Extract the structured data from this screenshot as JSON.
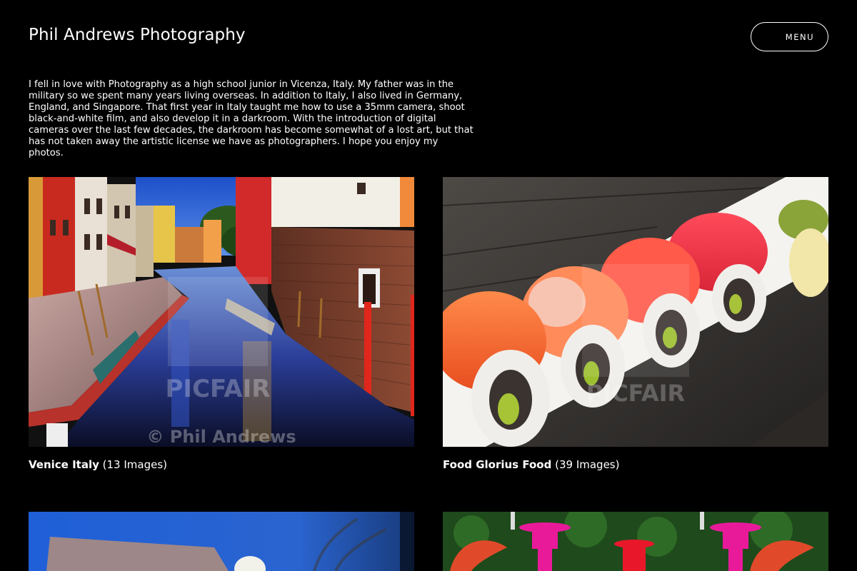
{
  "header": {
    "site_title": "Phil Andrews Photography",
    "menu_label": "MENU"
  },
  "intro": {
    "text": "I fell in love with Photography as a high school junior in Vicenza, Italy. My father was in the military so we spent many years living overseas. In addition to Italy, I also lived in Germany, England, and Singapore. That first year in Italy taught me how to use a 35mm camera, shoot black-and-white film, and also develop it in a darkroom. With the introduction of digital cameras over the last few decades, the darkroom has become somewhat of a lost art, but that has not taken away the artistic license we have as photographers. I hope you enjoy my photos."
  },
  "galleries": [
    {
      "title": "Venice Italy",
      "count": "(13 Images)",
      "watermark_brand": "PICFAIR",
      "watermark_copyright": "© Phil Andrews"
    },
    {
      "title": "Food Glorius Food",
      "count": "(39 Images)",
      "watermark_brand": "PICFAIR"
    },
    {},
    {}
  ],
  "colors": {
    "background": "#000000",
    "text": "#ffffff"
  },
  "icons": {}
}
